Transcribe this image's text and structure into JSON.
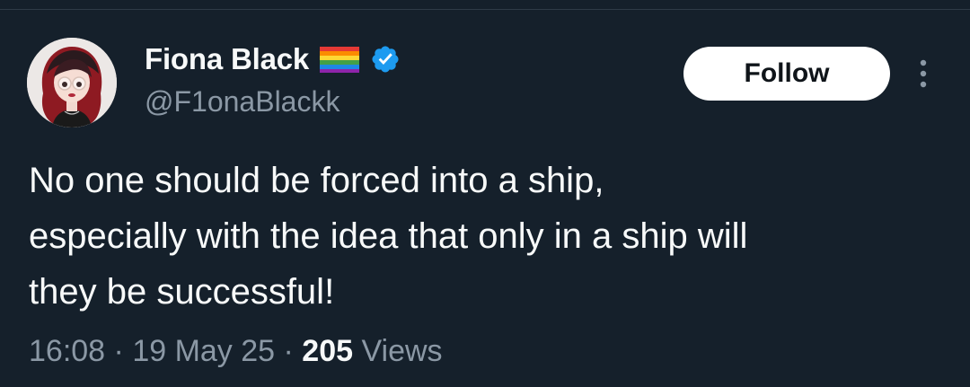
{
  "author": {
    "display_name": "Fiona Black",
    "handle": "@F1onaBlackk",
    "flag_icon": "rainbow-flag-icon",
    "verified_icon": "verified-badge-icon",
    "verified_color": "#1d9bf0"
  },
  "actions": {
    "follow_label": "Follow",
    "more_icon": "more-vertical-icon"
  },
  "tweet": {
    "lines": [
      "No one should be forced into a ship,",
      "especially with the idea that only in a ship will",
      "they be successful!"
    ]
  },
  "meta": {
    "time": "16:08",
    "separator": " · ",
    "date": "19 May 25",
    "views_count": "205",
    "views_label": " Views"
  },
  "colors": {
    "background": "#15202b",
    "text": "#f7f9f9",
    "secondary_text": "#8b98a5"
  }
}
